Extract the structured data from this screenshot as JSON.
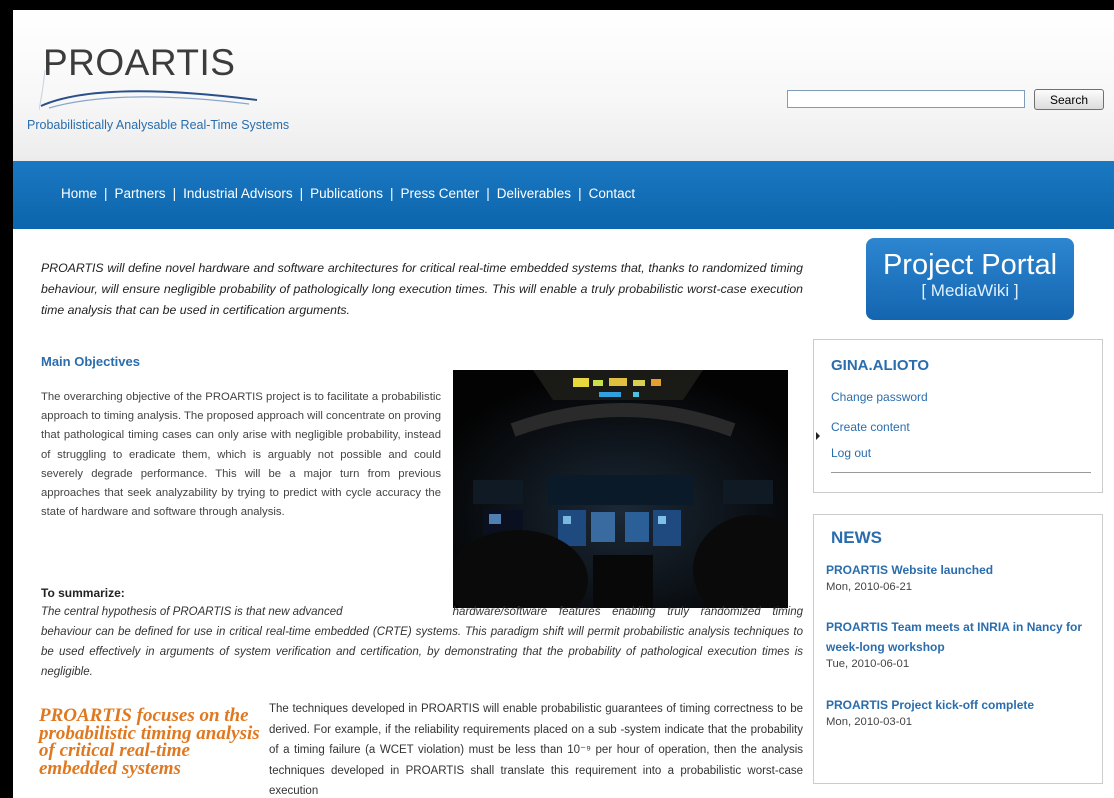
{
  "site": {
    "logo_text": "PROARTIS",
    "tagline": "Probabilistically Analysable Real-Time Systems",
    "search": {
      "placeholder": "",
      "button_label": "Search"
    }
  },
  "nav": {
    "items": [
      "Home",
      "Partners",
      "Industrial Advisors",
      "Publications",
      "Press Center",
      "Deliverables",
      "Contact"
    ],
    "separator": "|"
  },
  "main": {
    "intro": "PROARTIS will define novel hardware and software architectures for critical real-time embedded systems that, thanks to randomized timing behaviour, will ensure negligible probability of pathologically long execution times. This will enable a truly probabilistic worst-case execution time analysis that can be used in certification arguments.",
    "objectives_heading": "Main Objectives",
    "objectives_text": "The overarching objective of the PROARTIS project is to facilitate a probabilistic approach to timing analysis. The proposed approach will concentrate on proving that pathological timing cases can only arise with negligible probability, instead of struggling to eradicate them, which is arguably not possible and could severely degrade performance. This will be a major turn from previous approaches that seek analyzability by trying to predict with cycle accuracy the state of hardware and software through analysis.",
    "summary_heading": "To summarize:",
    "summary_line1": "The central hypothesis of PROARTIS is that new advanced",
    "summary_rest": "hardware/software features enabling truly randomized timing behaviour can be defined for use in critical real-time embedded (CRTE) systems. This paradigm shift will permit probabilistic analysis techniques to be used effectively in arguments of system verification and certification, by demonstrating that the probability of pathological execution times is negligible.",
    "pull_quote": "PROARTIS focuses on the probabilistic timing analysis of critical real-time embedded systems",
    "techniques_text": "The techniques developed in PROARTIS will enable probabilistic guarantees of timing correctness to be derived. For example, if the reliability requirements placed on a sub -system indicate that the probability of a timing failure (a WCET violation) must be less than 10⁻⁹ per hour of operation, then the analysis techniques developed in PROARTIS shall translate this requirement into a probabilistic worst-case execution"
  },
  "sidebar": {
    "portal": {
      "title": "Project Portal",
      "subtitle": "[ MediaWiki ]"
    },
    "user": {
      "name": "GINA.ALIOTO",
      "links": [
        "Change password",
        "Create content",
        "Log out"
      ]
    },
    "news": {
      "title": "NEWS",
      "items": [
        {
          "title": "PROARTIS Website launched",
          "date": "Mon, 2010-06-21"
        },
        {
          "title": "PROARTIS Team meets at INRIA in Nancy for week-long workshop",
          "date": "Tue, 2010-06-01"
        },
        {
          "title": "PROARTIS Project kick-off complete",
          "date": "Mon, 2010-03-01"
        }
      ]
    }
  },
  "colors": {
    "nav_blue": "#1570b8",
    "link_blue": "#2a6dad",
    "quote_orange": "#e07820"
  }
}
